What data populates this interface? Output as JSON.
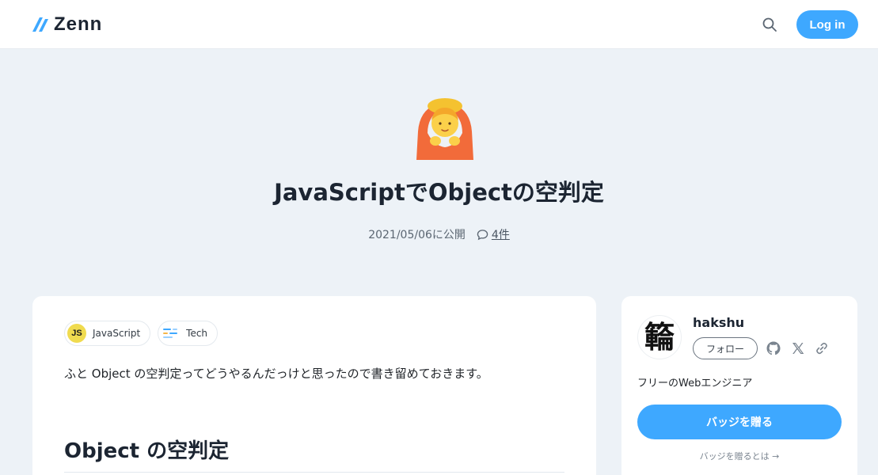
{
  "header": {
    "logo_text": "Zenn",
    "logo_icon": "zenn-logo-icon",
    "search_icon": "search-icon",
    "login_label": "Log in",
    "accent_color": "#3ea8ff"
  },
  "article": {
    "emoji_icon": "person-gesturing-ok-emoji",
    "title": "JavaScriptでObjectの空判定",
    "published": "2021/05/06に公開",
    "comment_icon": "comment-icon",
    "comment_count": "4件",
    "topics": [
      {
        "label": "JavaScript",
        "icon": "javascript-icon",
        "icon_text": "JS"
      },
      {
        "label": "Tech",
        "icon": "tech-icon"
      }
    ],
    "intro": "ふと Object の空判定ってどうやるんだっけと思ったので書き留めておきます。",
    "heading": "Object の空判定"
  },
  "author": {
    "avatar_glyph": "𥶡",
    "name": "hakshu",
    "follow_label": "フォロー",
    "social_icons": [
      "github-icon",
      "x-icon",
      "link-icon"
    ],
    "bio": "フリーのWebエンジニア",
    "badge_label": "バッジを贈る",
    "badge_help": "バッジを贈るとは →"
  }
}
